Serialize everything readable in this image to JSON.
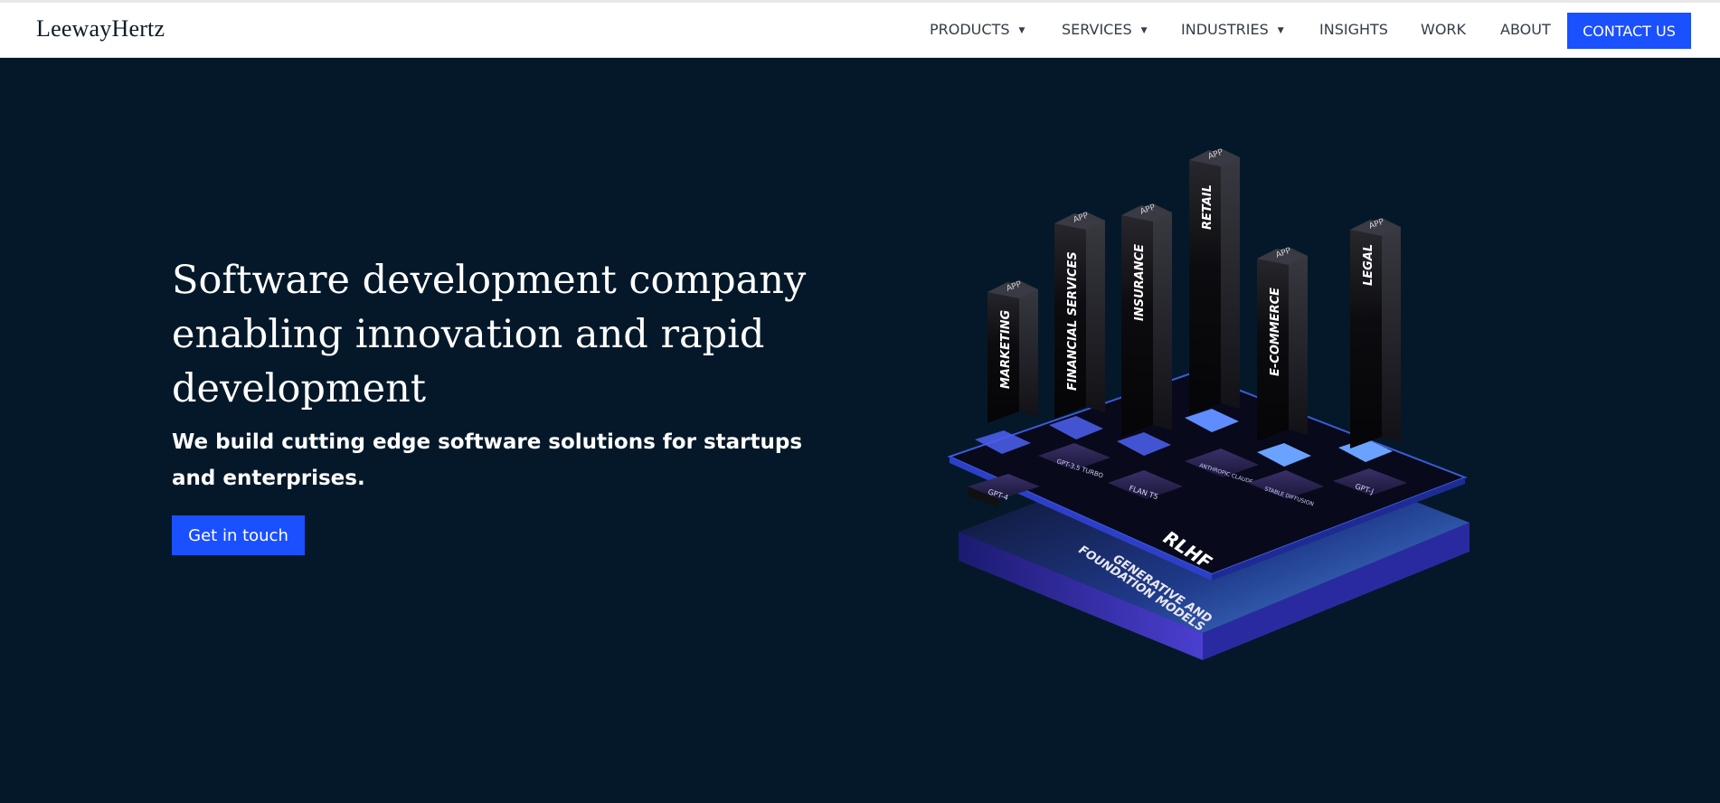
{
  "brand": {
    "logo_text": "LeewayHertz"
  },
  "nav": {
    "items": [
      {
        "label": "PRODUCTS",
        "has_dropdown": true
      },
      {
        "label": "SERVICES",
        "has_dropdown": true
      },
      {
        "label": "INDUSTRIES",
        "has_dropdown": true
      },
      {
        "label": "INSIGHTS",
        "has_dropdown": false
      },
      {
        "label": "WORK",
        "has_dropdown": false
      },
      {
        "label": "ABOUT",
        "has_dropdown": false
      }
    ],
    "dropdown_glyph": "▼",
    "contact_label": "CONTACT US"
  },
  "hero": {
    "headline": "Software development company enabling innovation and rapid development",
    "subheadline": "We build cutting edge software solutions for startups and enterprises.",
    "cta_label": "Get in touch"
  },
  "illustration": {
    "apps": [
      "MARKETING",
      "FINANCIAL SERVICES",
      "INSURANCE",
      "RETAIL",
      "E-COMMERCE",
      "LEGAL"
    ],
    "app_tag": "APP",
    "models": [
      "GPT-4",
      "GPT-3.5 TURBO",
      "FLAN T5",
      "ANTHROPIC CLAUDE",
      "STABLE DIFFUSION",
      "GPT-J"
    ],
    "layer_label": "RLHF",
    "base_label_1": "GENERATIVE AND",
    "base_label_2": "FOUNDATION MODELS"
  },
  "colors": {
    "background": "#041829",
    "accent": "#1a50ff",
    "navbar": "#ffffff",
    "text_dark": "#333d47"
  }
}
